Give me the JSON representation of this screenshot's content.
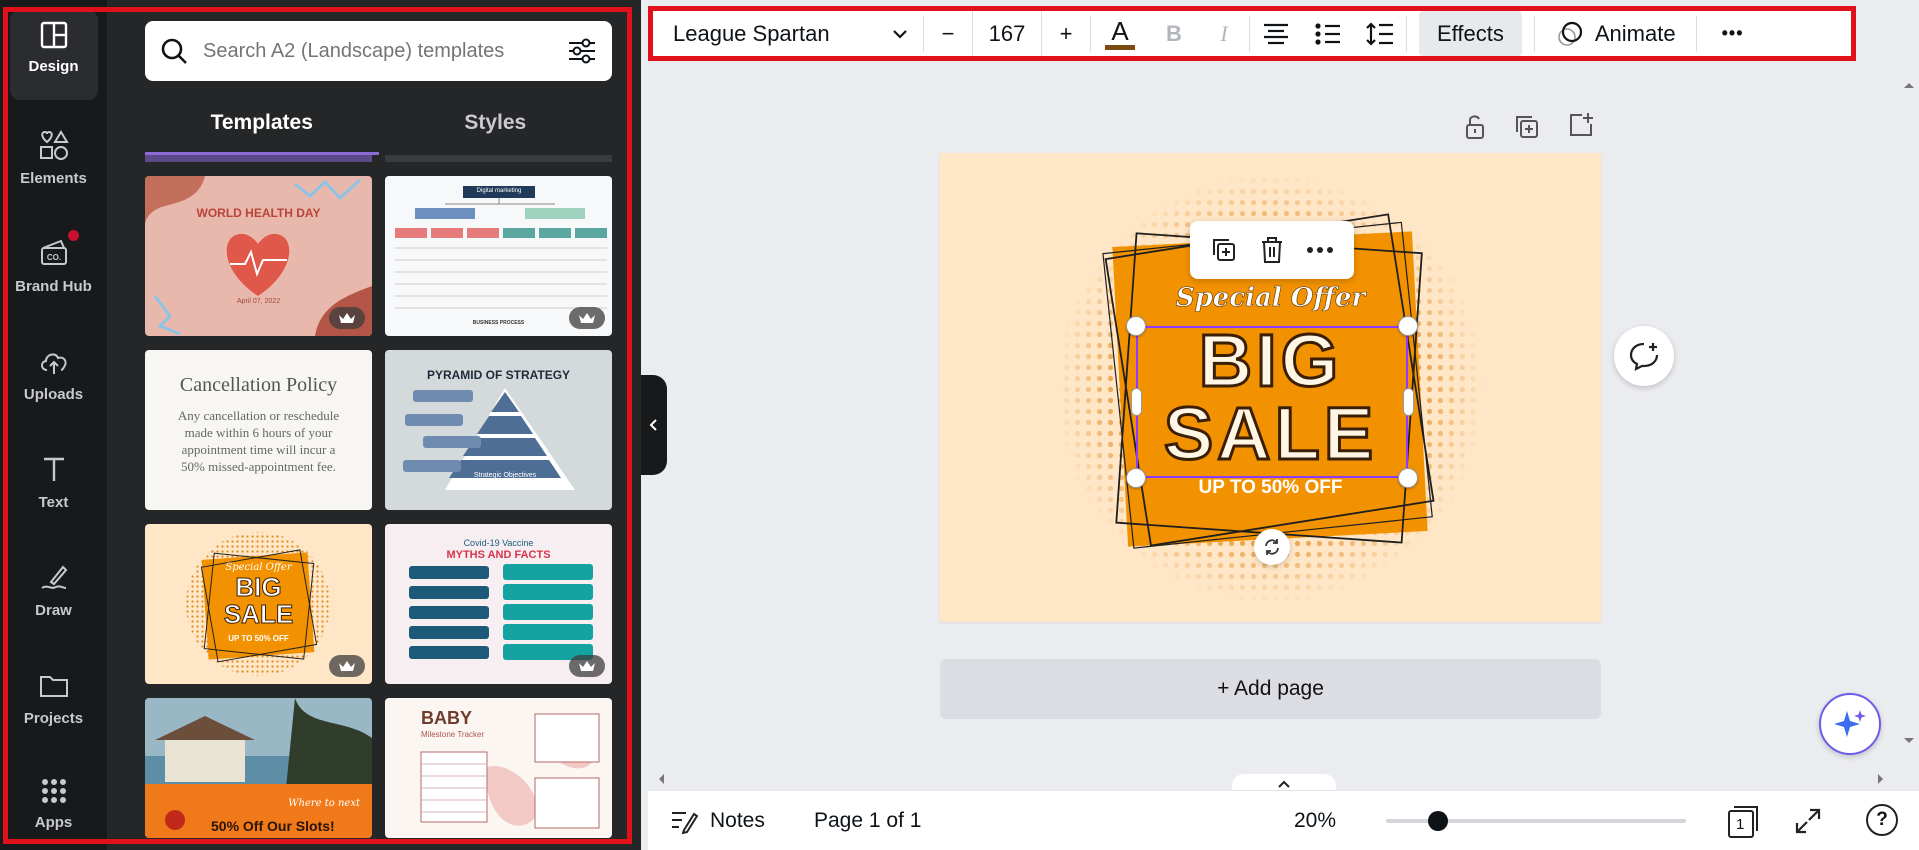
{
  "rail": {
    "items": [
      {
        "label": "Design",
        "icon": "layout-icon"
      },
      {
        "label": "Elements",
        "icon": "shapes-icon"
      },
      {
        "label": "Brand Hub",
        "icon": "brand-icon"
      },
      {
        "label": "Uploads",
        "icon": "cloud-upload-icon"
      },
      {
        "label": "Text",
        "icon": "text-icon"
      },
      {
        "label": "Draw",
        "icon": "draw-icon"
      },
      {
        "label": "Projects",
        "icon": "folder-icon"
      },
      {
        "label": "Apps",
        "icon": "grid-icon"
      }
    ]
  },
  "panel": {
    "search_placeholder": "Search A2 (Landscape) templates",
    "tabs": [
      "Templates",
      "Styles"
    ],
    "templates": [
      {
        "title": "WORLD HEALTH DAY",
        "subtitle": "April 07, 2022"
      },
      {
        "title": "Digital marketing",
        "subtitle": "BUSINESS PROCESS"
      },
      {
        "title": "Cancellation Policy",
        "subtitle": "Any cancellation or reschedule made within 6 hours of your appointment time will incur a 50% missed-appointment fee."
      },
      {
        "title": "PYRAMID OF STRATEGY",
        "subtitle": "Strategic Objectives"
      },
      {
        "title": "BIG SALE",
        "subtitle": "Special Offer",
        "tag": "UP TO 50% OFF"
      },
      {
        "title": "MYTHS AND FACTS",
        "subtitle": "Covid-19 Vaccine"
      },
      {
        "title": "50% Off Our Slots!",
        "subtitle": "Where to next"
      },
      {
        "title": "BABY",
        "subtitle": "Milestone Tracker"
      }
    ]
  },
  "toolbar": {
    "font": "League Spartan",
    "minus": "−",
    "font_size": "167",
    "plus": "+",
    "text_color_label": "A",
    "bold": "B",
    "italic": "I",
    "effects": "Effects",
    "animate": "Animate",
    "more": "•••"
  },
  "canvas": {
    "special_offer": "Special Offer",
    "big": "BIG",
    "sale": "SALE",
    "discount": "UP TO 50% OFF",
    "add_page": "+ Add page"
  },
  "bottom": {
    "notes": "Notes",
    "page": "Page 1 of 1",
    "zoom": "20%",
    "zoom_level": 0.2,
    "pages_count": "1",
    "help": "?"
  },
  "colors": {
    "accent": "#8b6bd6",
    "highlight_border": "#e0111b",
    "orange": "#f39200",
    "design_bg": "#ffe6c6"
  }
}
